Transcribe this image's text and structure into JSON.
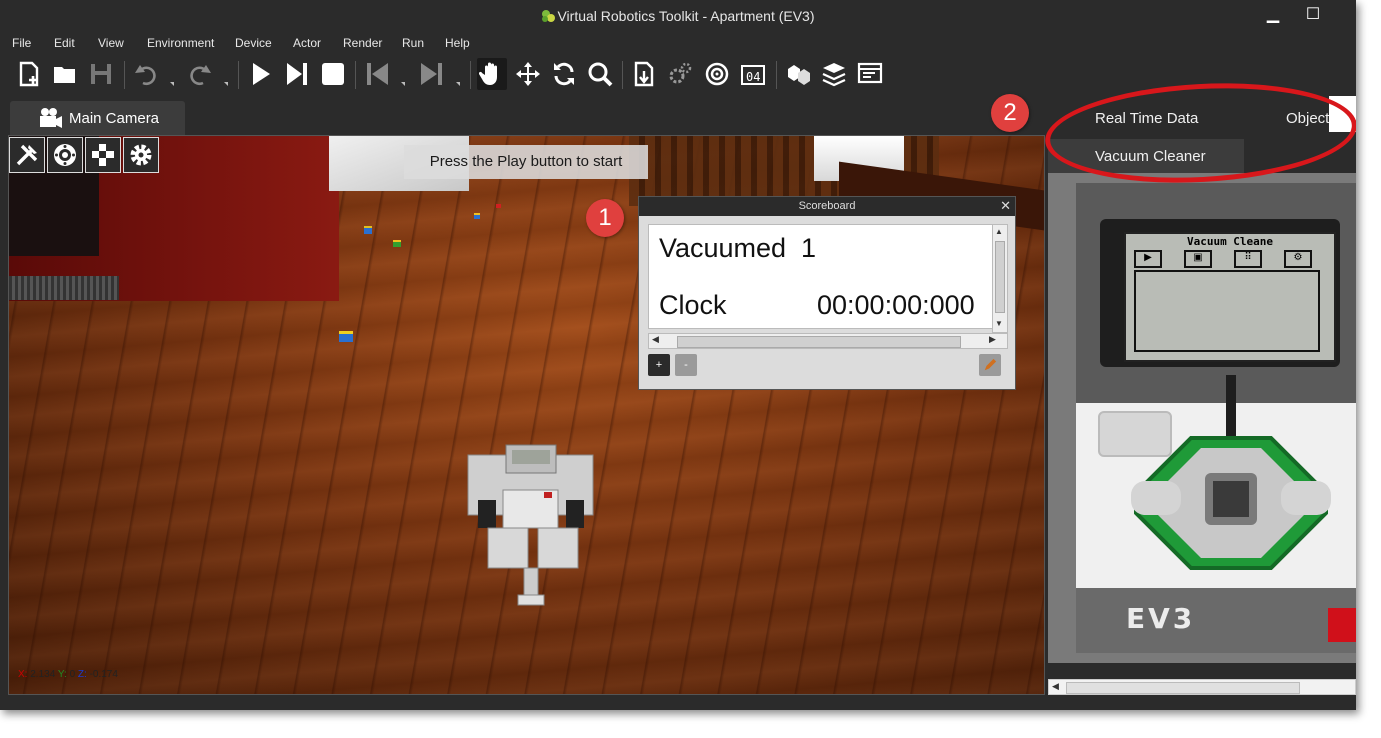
{
  "window": {
    "title": "Virtual Robotics Toolkit - Apartment (EV3)",
    "minimize_glyph": "▁",
    "maximize_glyph": "☐"
  },
  "menu": [
    "File",
    "Edit",
    "View",
    "Environment",
    "Device",
    "Actor",
    "Render",
    "Run",
    "Help"
  ],
  "toolbar": {
    "icons": [
      "new-file-icon",
      "open-folder-icon",
      "save-icon",
      "undo-icon",
      "redo-icon",
      "play-icon",
      "step-forward-icon",
      "stop-icon",
      "rewind-icon",
      "next-icon",
      "hand-pan-icon",
      "move-icon",
      "rotate-icon",
      "zoom-icon",
      "import-icon",
      "gears-icon",
      "target-icon",
      "count-icon",
      "cubes-icon",
      "layers-icon",
      "monitor-icon"
    ],
    "active_tool": "hand-pan-icon"
  },
  "viewport": {
    "tab_label": "Main Camera",
    "hint": "Press the Play button to start",
    "tools": [
      "tools-icon",
      "controller-icon",
      "checker-icon",
      "settings-icon"
    ],
    "coords": {
      "x_label": "X:",
      "x": "2.134",
      "y_label": "Y:",
      "y": "0",
      "z_label": "Z:",
      "z": "-0.174"
    },
    "coord_colors": {
      "x": "#cc0000",
      "y": "#228b22",
      "z": "#1a3ad0"
    }
  },
  "badges": [
    "1",
    "2"
  ],
  "scoreboard": {
    "title": "Scoreboard",
    "close": "✕",
    "rows": [
      {
        "name": "Vacuumed",
        "value": "1"
      },
      {
        "name": "Clock",
        "value": "00:00:00:000"
      }
    ],
    "add_button": "+",
    "remove_button": "-"
  },
  "right_panel": {
    "tabs": [
      "Real Time Data",
      "Objecti"
    ],
    "active_tab": "Vacuum Cleaner",
    "brick": {
      "screen_title": "Vacuum Cleane",
      "logo_text": "EV3"
    }
  },
  "colors": {
    "accent_red": "#e0403e",
    "annotation_red": "#d8171b",
    "brick_green": "#22a23a"
  }
}
